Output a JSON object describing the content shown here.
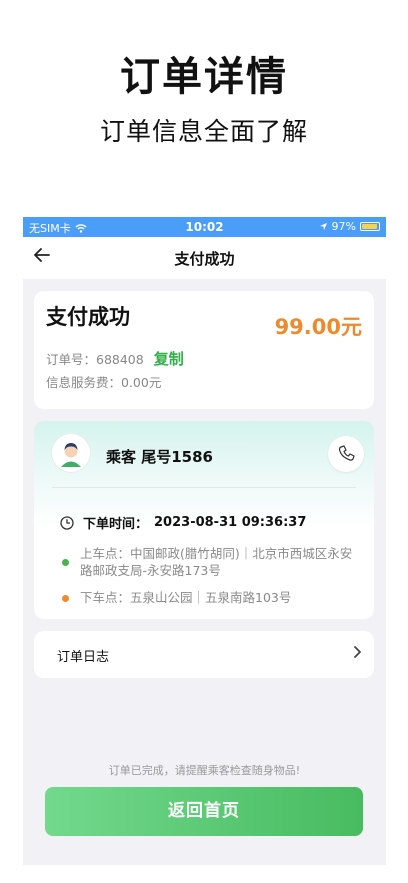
{
  "hero": {
    "title": "订单详情",
    "subtitle": "订单信息全面了解"
  },
  "statusbar": {
    "carrier": "无SIM卡",
    "time": "10:02",
    "battery": "97%"
  },
  "nav": {
    "title": "支付成功"
  },
  "payment": {
    "title": "支付成功",
    "amount": "99.00元",
    "order_no_label": "订单号：688408",
    "copy_label": "复制",
    "fee_label": "信息服务费：0.00元"
  },
  "trip": {
    "passenger": "乘客 尾号1586",
    "time_label": "下单时间：",
    "time_value": "2023-08-31 09:36:37",
    "pickup": "上车点：中国邮政(腊竹胡同)｜北京市西城区永安路邮政支局-永安路173号",
    "dropoff": "下车点：五泉山公园｜五泉南路103号"
  },
  "log": {
    "label": "订单日志"
  },
  "notice": "订单已完成，请提醒乘客检查随身物品!",
  "home_button": "返回首页",
  "colors": {
    "accent": "#48bb60",
    "amount": "#ee8a2e",
    "statusbar": "#4b9ef8"
  }
}
